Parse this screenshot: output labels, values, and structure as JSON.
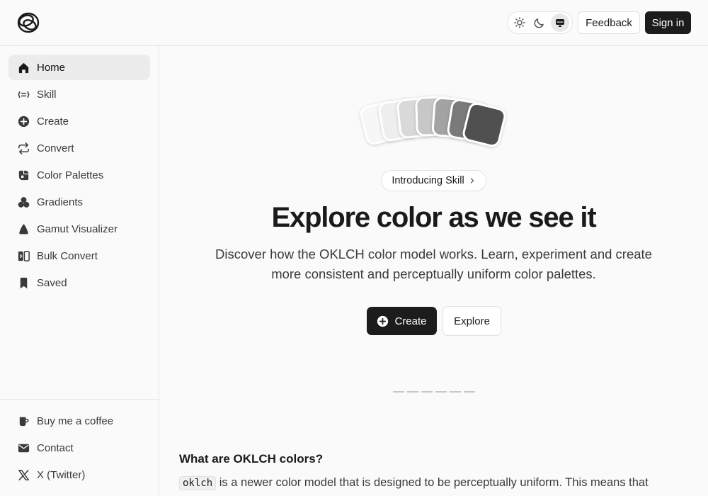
{
  "header": {
    "logo_icon": "oklch-logo-icon",
    "theme": {
      "options": [
        "sun-icon",
        "moon-icon",
        "system-icon"
      ],
      "active": "system"
    },
    "feedback_label": "Feedback",
    "signin_label": "Sign in"
  },
  "sidebar": {
    "items": [
      {
        "label": "Home",
        "icon": "home-icon",
        "active": true
      },
      {
        "label": "Skill",
        "icon": "skill-icon"
      },
      {
        "label": "Create",
        "icon": "plus-circle-icon"
      },
      {
        "label": "Convert",
        "icon": "convert-icon"
      },
      {
        "label": "Color Palettes",
        "icon": "palette-icon"
      },
      {
        "label": "Gradients",
        "icon": "gradients-icon"
      },
      {
        "label": "Gamut Visualizer",
        "icon": "gamut-icon"
      },
      {
        "label": "Bulk Convert",
        "icon": "bulk-convert-icon"
      },
      {
        "label": "Saved",
        "icon": "bookmark-icon"
      }
    ],
    "footer": [
      {
        "label": "Buy me a coffee",
        "icon": "coffee-icon"
      },
      {
        "label": "Contact",
        "icon": "mail-icon"
      },
      {
        "label": "X (Twitter)",
        "icon": "x-icon"
      }
    ]
  },
  "hero": {
    "swatch_colors": [
      "#f7f7f7",
      "#eeeeee",
      "#d9d9d9",
      "#c7c7c7",
      "#a3a3a3",
      "#7a7a7a",
      "#505050"
    ],
    "pill_label": "Introducing Skill",
    "title": "Explore color as we see it",
    "subtitle": "Discover how the OKLCH color model works. Learn, experiment and create more consistent and perceptually uniform color palettes.",
    "create_label": "Create",
    "explore_label": "Explore"
  },
  "content": {
    "section_title": "What are OKLCH colors?",
    "code_token": "oklch",
    "paragraph": " is a newer color model that is designed to be perceptually uniform. This means that"
  }
}
